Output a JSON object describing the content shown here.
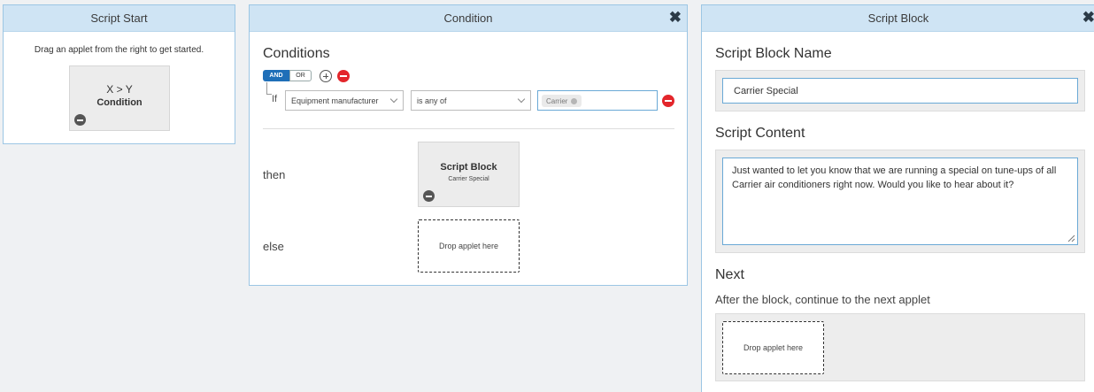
{
  "script_start": {
    "title": "Script Start",
    "hint": "Drag an applet from the right to get started.",
    "applet": {
      "line1": "X > Y",
      "line2": "Condition"
    }
  },
  "condition": {
    "title": "Condition",
    "close_label": "✖",
    "conditions_title": "Conditions",
    "logic_toggle": {
      "and": "AND",
      "or": "OR",
      "selected": "AND"
    },
    "if_label": "If",
    "field_select": "Equipment manufacturer",
    "operator_select": "is any of",
    "value_tags": [
      "Carrier"
    ],
    "then_label": "then",
    "then_applet": {
      "title": "Script Block",
      "subtitle": "Carrier Special"
    },
    "else_label": "else",
    "else_drop": "Drop applet here"
  },
  "script_block": {
    "title": "Script Block",
    "close_label": "✖",
    "name_label": "Script Block Name",
    "name_value": "Carrier Special",
    "content_label": "Script Content",
    "content_value": "Just wanted to let you know that we are running a special on tune-ups of all Carrier air conditioners right now. Would you like to hear about it?",
    "next_label": "Next",
    "next_description": "After the block, continue to the next applet",
    "next_drop": "Drop applet here"
  },
  "colors": {
    "header_bg": "#cfe4f4",
    "accent_blue": "#1f6fb8",
    "remove_red": "#e3262b"
  }
}
